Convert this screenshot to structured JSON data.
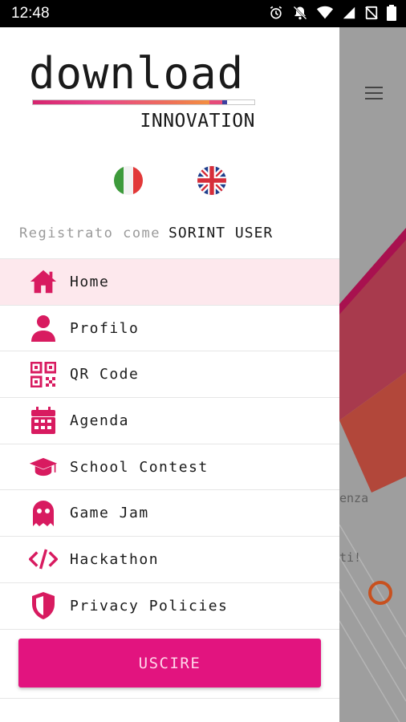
{
  "status_bar": {
    "time": "12:48",
    "icons": [
      "alarm-icon",
      "notifications-off-icon",
      "wifi-icon",
      "signal-icon",
      "no-sim-icon",
      "battery-icon"
    ]
  },
  "logo": {
    "word": "download",
    "subtitle": "INNOVATION"
  },
  "languages": [
    {
      "code": "it",
      "icon": "italy-flag-icon"
    },
    {
      "code": "en",
      "icon": "uk-flag-icon"
    }
  ],
  "registered": {
    "prefix": "Registrato come",
    "user": "SORINT USER"
  },
  "menu": [
    {
      "label": "Home",
      "icon": "home-icon",
      "active": true
    },
    {
      "label": "Profilo",
      "icon": "person-icon"
    },
    {
      "label": "QR Code",
      "icon": "qr-code-icon"
    },
    {
      "label": "Agenda",
      "icon": "calendar-icon"
    },
    {
      "label": "School Contest",
      "icon": "graduation-cap-icon"
    },
    {
      "label": "Game Jam",
      "icon": "ghost-icon"
    },
    {
      "label": "Hackathon",
      "icon": "code-icon"
    },
    {
      "label": "Privacy Policies",
      "icon": "shield-icon"
    }
  ],
  "logout_label": "USCIRE",
  "background": {
    "fragments": [
      "enza",
      "ti!"
    ]
  },
  "colors": {
    "accent": "#e2147f",
    "icon": "#d81b60",
    "active_row": "#fde8ed",
    "status_bar": "#000000"
  }
}
